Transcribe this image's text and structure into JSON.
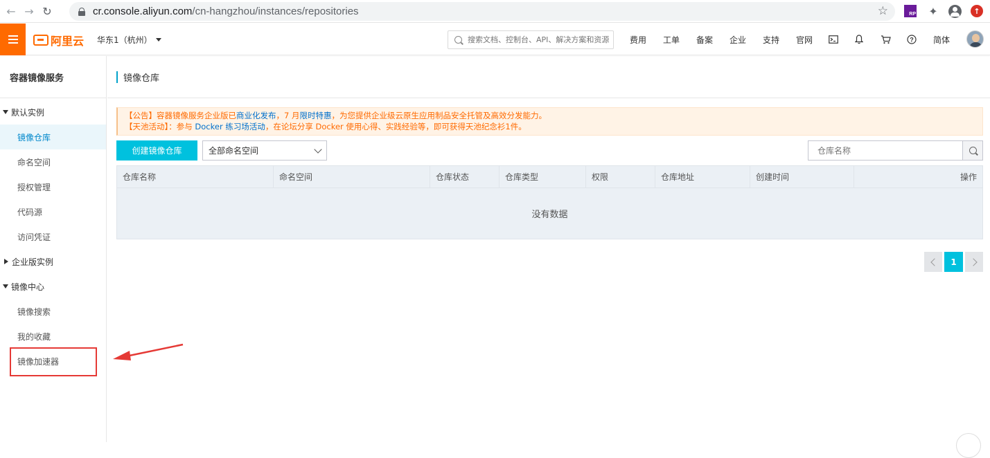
{
  "browser": {
    "url_host": "cr.console.aliyun.com",
    "url_path": "/cn-hangzhou/instances/repositories",
    "extension_rp": "RP"
  },
  "topbar": {
    "logo_text": "阿里云",
    "region": "华东1（杭州）",
    "search_placeholder": "搜索文档、控制台、API、解决方案和资源",
    "links": [
      "费用",
      "工单",
      "备案",
      "企业",
      "支持",
      "官网"
    ],
    "language": "简体"
  },
  "sidebar": {
    "title": "容器镜像服务",
    "groups": [
      {
        "label": "默认实例",
        "expanded": true
      },
      {
        "label": "企业版实例",
        "expanded": false
      },
      {
        "label": "镜像中心",
        "expanded": true
      }
    ],
    "default_items": [
      "镜像仓库",
      "命名空间",
      "授权管理",
      "代码源",
      "访问凭证"
    ],
    "center_items": [
      "镜像搜索",
      "我的收藏",
      "镜像加速器"
    ],
    "active_item": "镜像仓库"
  },
  "page": {
    "title": "镜像仓库",
    "notice": {
      "line1_pre": "【公告】容器镜像服务企业版已",
      "line1_link1": "商业化发布",
      "line1_mid": "，7 月",
      "line1_link2": "限时特惠",
      "line1_post": "，为您提供企业级云原生应用制品安全托管及高效分发能力。",
      "line2_pre": "【天池活动】：参与 ",
      "line2_link": "Docker 练习场活动",
      "line2_post": "，在论坛分享 Docker 使用心得、实践经验等，即可获得天池纪念衫1件。"
    },
    "create_button": "创建镜像仓库",
    "namespace_select": "全部命名空间",
    "repo_search_placeholder": "仓库名称",
    "table_headers": [
      "仓库名称",
      "命名空间",
      "仓库状态",
      "仓库类型",
      "权限",
      "仓库地址",
      "创建时间",
      "操作"
    ],
    "empty_text": "没有数据",
    "pagination": {
      "current_page": "1"
    }
  },
  "colors": {
    "brand": "#ff6a00",
    "accent": "#00c1de",
    "annotation": "#e53935"
  }
}
